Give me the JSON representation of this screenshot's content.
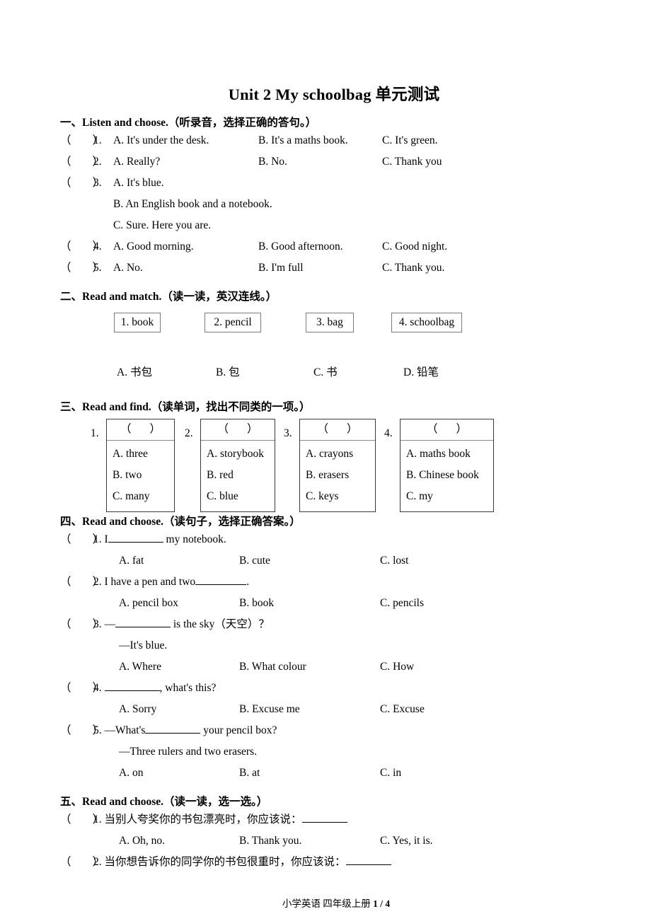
{
  "document": {
    "title": "Unit 2 My schoolbag  单元测试",
    "footer": {
      "subject": "小学英语  四年级上册",
      "page": "1 / 4"
    }
  },
  "brackets": {
    "left": "（",
    "right": "）"
  },
  "sections": [
    {
      "id": "section-1",
      "number": "一、",
      "title_en": "Listen and choose.",
      "title_cn": "（听录音，选择正确的答句。）",
      "questions": [
        {
          "num": "1.",
          "options": [
            "A. It's under the desk.",
            "B. It's a maths book.",
            "C. It's green."
          ]
        },
        {
          "num": "2.",
          "options": [
            "A. Really?",
            "B. No.",
            "C. Thank you"
          ]
        },
        {
          "num": "3.",
          "options": [
            "A. It's blue.",
            "B. An English book and a notebook.",
            "C. Sure. Here you are."
          ]
        },
        {
          "num": "4.",
          "options": [
            "A. Good morning.",
            "B. Good afternoon.",
            "C. Good night."
          ]
        },
        {
          "num": "5.",
          "options": [
            "A. No.",
            "B. I'm full",
            "C. Thank you."
          ]
        }
      ]
    },
    {
      "id": "section-2",
      "number": "二、",
      "title_en": "Read and match.",
      "title_cn": "（读一读，英汉连线。）",
      "word_boxes": [
        "1. book",
        "2. pencil",
        "3. bag",
        "4. schoolbag"
      ],
      "meaning_options": [
        "A. 书包",
        "B. 包",
        "C. 书",
        "D. 铅笔"
      ]
    },
    {
      "id": "section-3",
      "number": "三、",
      "title_en": "Read and find.",
      "title_cn": "（读单词，找出不同类的一项。）",
      "items": [
        {
          "num": "1.",
          "options": [
            "A. three",
            "B. two",
            "C. many"
          ]
        },
        {
          "num": "2.",
          "options": [
            "A. storybook",
            "B. red",
            "C. blue"
          ]
        },
        {
          "num": "3.",
          "options": [
            "A. crayons",
            "B. erasers",
            "C. keys"
          ]
        },
        {
          "num": "4.",
          "options": [
            "A. maths book",
            "B. Chinese book",
            "C. my"
          ]
        }
      ]
    },
    {
      "id": "section-4",
      "number": "四、",
      "title_en": "Read and choose.",
      "title_cn": "（读句子，选择正确答案。）",
      "questions": [
        {
          "num": "1.",
          "stem_before": "I",
          "stem_after": "my notebook.",
          "options": [
            "A. fat",
            "B. cute",
            "C. lost"
          ]
        },
        {
          "num": "2.",
          "stem_before": "I have a pen and two",
          "stem_after": ".",
          "options": [
            "A. pencil box",
            "B. book",
            "C. pencils"
          ]
        },
        {
          "num": "3.",
          "stem_before": "—",
          "stem_after": "is the sky（天空）？",
          "stem_line2": "—It's blue.",
          "options": [
            "A. Where",
            "B. What colour",
            "C. How"
          ]
        },
        {
          "num": "4.",
          "stem_before": "",
          "stem_after": ", what's this?",
          "options": [
            "A. Sorry",
            "B. Excuse me",
            "C. Excuse"
          ]
        },
        {
          "num": "5.",
          "stem_before": "—What's",
          "stem_after": "your pencil box?",
          "stem_line2": "—Three rulers and two erasers.",
          "options": [
            "A. on",
            "B. at",
            "C. in"
          ]
        }
      ]
    },
    {
      "id": "section-5",
      "number": "五、",
      "title_en": "Read and choose.",
      "title_cn": "（读一读，选一选。）",
      "questions": [
        {
          "num": "1.",
          "stem_before": "当别人夸奖你的书包漂亮时，你应该说：",
          "options": [
            "A. Oh, no.",
            "B. Thank you.",
            "C. Yes, it is."
          ]
        },
        {
          "num": "2.",
          "stem_before": "当你想告诉你的同学你的书包很重时，你应该说：",
          "options": []
        }
      ]
    }
  ]
}
